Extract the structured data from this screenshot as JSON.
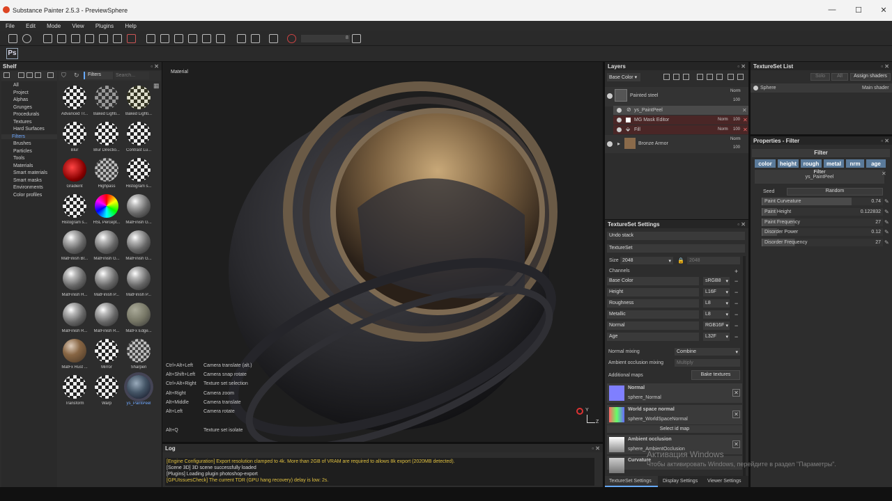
{
  "window": {
    "title": "Substance Painter 2.5.3 - PreviewSphere",
    "min": "—",
    "max": "☐",
    "close": "✕"
  },
  "menu": [
    "File",
    "Edit",
    "Mode",
    "View",
    "Plugins",
    "Help"
  ],
  "toolbar": {
    "ps_label": "Ps",
    "field_value": "8"
  },
  "shelf": {
    "title": "Shelf",
    "filter_label": "Filters",
    "search_placeholder": "Search...",
    "categories": [
      "All",
      "Project",
      "Alphas",
      "Grunges",
      "Procedurals",
      "Textures",
      "Hard Surfaces",
      "Filters",
      "Brushes",
      "Particles",
      "Tools",
      "Materials",
      "Smart materials",
      "Smart masks",
      "Environments",
      "Color profiles"
    ],
    "selected_category": "Filters",
    "items": [
      {
        "label": "Advanced Tr...",
        "style": "checker"
      },
      {
        "label": "Baked Lighti...",
        "style": "checkmetal"
      },
      {
        "label": "Baked Lighti...",
        "style": "checkgold"
      },
      {
        "label": "Blur",
        "style": "checker"
      },
      {
        "label": "Blur Directio...",
        "style": "checker"
      },
      {
        "label": "Contrast Lu...",
        "style": "checker"
      },
      {
        "label": "Gradient",
        "style": "red"
      },
      {
        "label": "Highpass",
        "style": "checkgray"
      },
      {
        "label": "Histogram s...",
        "style": "checker"
      },
      {
        "label": "Histogram s...",
        "style": "checker"
      },
      {
        "label": "HSL Percept...",
        "style": "rainbow"
      },
      {
        "label": "MatFinish G...",
        "style": "metal"
      },
      {
        "label": "MatFinish Br...",
        "style": "metal"
      },
      {
        "label": "MatFinish G...",
        "style": "metal"
      },
      {
        "label": "MatFinish G...",
        "style": "metal"
      },
      {
        "label": "MatFinish H...",
        "style": "metal"
      },
      {
        "label": "MatFinish P...",
        "style": "metal"
      },
      {
        "label": "MatFinish P...",
        "style": "metal"
      },
      {
        "label": "MatFinish R...",
        "style": "metal"
      },
      {
        "label": "MatFinish R...",
        "style": "metal"
      },
      {
        "label": "MatFx Edge...",
        "style": "olive"
      },
      {
        "label": "MatFx Rust ...",
        "style": "rust"
      },
      {
        "label": "Mirror",
        "style": "checker"
      },
      {
        "label": "Sharpen",
        "style": "checkgray"
      },
      {
        "label": "Transform",
        "style": "checker"
      },
      {
        "label": "Warp",
        "style": "checker"
      },
      {
        "label": "ys_PaintPeel",
        "style": "peel"
      }
    ],
    "selected_item": "ys_PaintPeel"
  },
  "viewport": {
    "label": "Material",
    "shortcuts": [
      {
        "keys": "Ctrl+Alt+Left",
        "action": "Camera translate (alt.)"
      },
      {
        "keys": "Alt+Shift+Left",
        "action": "Camera snap rotate"
      },
      {
        "keys": "Ctrl+Alt+Right",
        "action": "Texture set selection"
      },
      {
        "keys": "Alt+Right",
        "action": "Camera zoom"
      },
      {
        "keys": "Alt+Middle",
        "action": "Camera translate"
      },
      {
        "keys": "Alt+Left",
        "action": "Camera rotate"
      },
      {
        "keys": "Alt+Q",
        "action": "Texture set isolate"
      }
    ],
    "axis_y": "Y",
    "axis_z": "Z"
  },
  "log": {
    "title": "Log",
    "lines": [
      {
        "text": "[Engine Configuration] Export resolution clamped to 4k. More than 2GB of VRAM are required to allows 8k export (2020MB detected).",
        "color": "#e0c040"
      },
      {
        "text": "[Scene 3D] 3D scene successfully loaded",
        "color": "#dddddd"
      },
      {
        "text": "[Plugins] Loading plugin photoshop-export",
        "color": "#dddddd"
      },
      {
        "text": "[GPUIssuesCheck] The current TDR (GPU hang recovery) delay is low: 2s.",
        "color": "#e0c040"
      }
    ]
  },
  "layers": {
    "title": "Layers",
    "channel": "Base Color",
    "items": [
      {
        "name": "Painted steel",
        "blend": "Norm",
        "opacity": "100"
      },
      {
        "name": "ys_PaintPeel",
        "blend": "",
        "opacity": ""
      },
      {
        "name": "MG Mask Editor",
        "blend": "Norm",
        "opacity": "100"
      },
      {
        "name": "Fill",
        "blend": "Norm",
        "opacity": "100"
      },
      {
        "name": "Bronze Armor",
        "blend": "Norm",
        "opacity": "100"
      }
    ]
  },
  "textureset_list": {
    "title": "TextureSet List",
    "btn_solo": "Solo",
    "btn_all": "All",
    "btn_assign": "Assign shaders",
    "item": "Sphere",
    "shader": "Main shader"
  },
  "properties": {
    "title": "Properties - Filter",
    "section": "Filter",
    "channels": [
      "color",
      "height",
      "rough",
      "metal",
      "nrm",
      "age"
    ],
    "filter_label": "Filter",
    "filter_name": "ys_PaintPeel",
    "seed_label": "Seed",
    "seed_button": "Random",
    "params": [
      {
        "label": "Paint Curveature",
        "value": "0.74",
        "fill": 0.74
      },
      {
        "label": "Paint Height",
        "value": "0.122832",
        "fill": 0.12
      },
      {
        "label": "Paint Frequency",
        "value": "27",
        "fill": 0.27
      },
      {
        "label": "Disorder Power",
        "value": "0.12",
        "fill": 0.12
      },
      {
        "label": "Disorder Frequency",
        "value": "27",
        "fill": 0.27
      }
    ]
  },
  "textureset_settings": {
    "title": "TextureSet Settings",
    "undo": "Undo stack",
    "textureset": "TextureSet",
    "size_label": "Size",
    "size_value": "2048",
    "size_value2": "2048",
    "channels_label": "Channels",
    "channels": [
      {
        "name": "Base Color",
        "format": "sRGB8"
      },
      {
        "name": "Height",
        "format": "L16F"
      },
      {
        "name": "Roughness",
        "format": "L8"
      },
      {
        "name": "Metallic",
        "format": "L8"
      },
      {
        "name": "Normal",
        "format": "RGB16F"
      },
      {
        "name": "Age",
        "format": "L32F"
      }
    ],
    "normal_mixing_label": "Normal mixing",
    "normal_mixing_value": "Combine",
    "ao_mixing_label": "Ambient occlusion mixing",
    "ao_mixing_value": "Multiply",
    "additional_maps": "Additional maps",
    "bake_button": "Bake textures",
    "maps": [
      {
        "title": "Normal",
        "file": "sphere_Normal"
      },
      {
        "title": "World space normal",
        "file": "sphere_WorldSpaceNormal"
      },
      {
        "title": "Ambient occlusion",
        "file": "sphere_AmbientOcclusion"
      },
      {
        "title": "Curvature",
        "file": ""
      }
    ],
    "select_id": "Select id map"
  },
  "bottom_tabs": [
    "TextureSet Settings",
    "Display Settings",
    "Viewer Settings"
  ],
  "watermark": {
    "line1": "Активация Windows",
    "line2": "Чтобы активировать Windows, перейдите в раздел \"Параметры\"."
  }
}
